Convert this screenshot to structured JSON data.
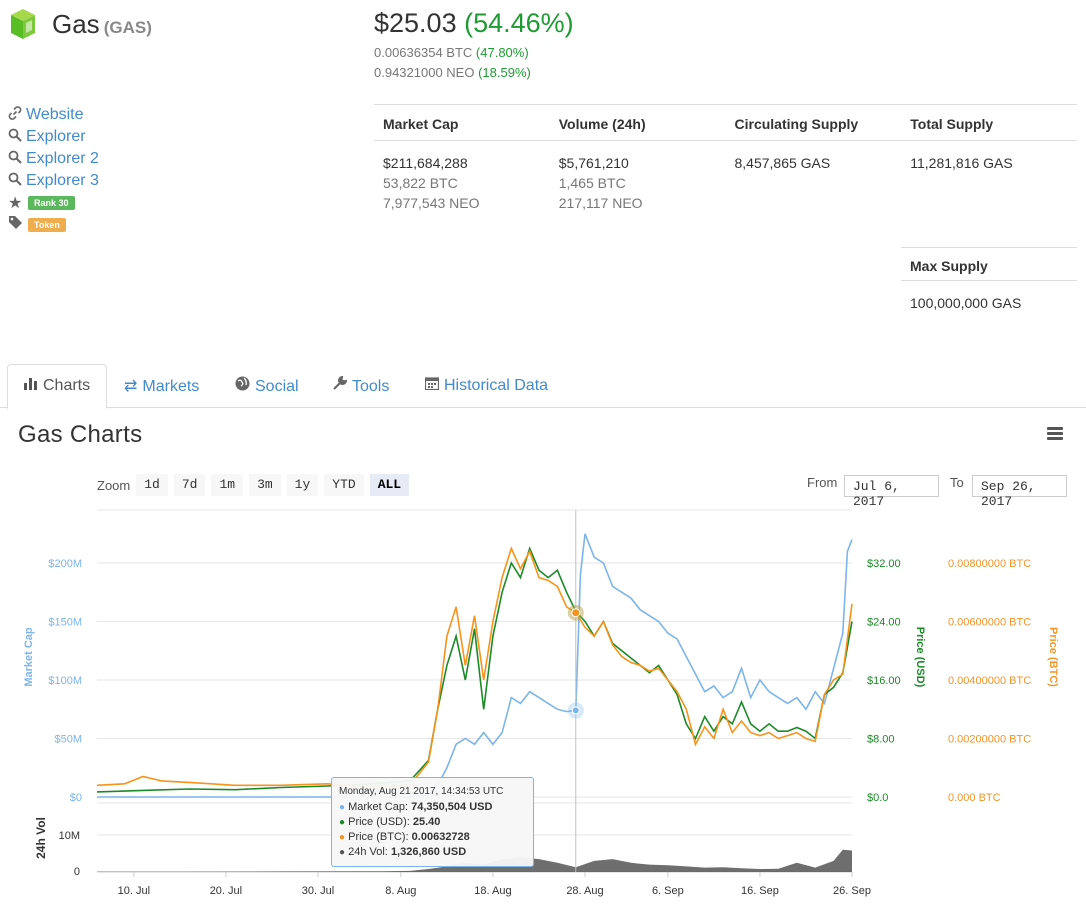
{
  "coin": {
    "name": "Gas",
    "symbol": "(GAS)",
    "price_usd": "$25.03",
    "change_usd": "(54.46%)",
    "price_btc": "0.00636354 BTC",
    "change_btc": "(47.80%)",
    "price_neo": "0.94321000 NEO",
    "change_neo": "(18.59%)"
  },
  "links": {
    "website": "Website",
    "explorer": "Explorer",
    "explorer2": "Explorer 2",
    "explorer3": "Explorer 3",
    "rank": "Rank 30",
    "token": "Token"
  },
  "stats": {
    "headers": [
      "Market Cap",
      "Volume (24h)",
      "Circulating Supply",
      "Total Supply"
    ],
    "market_cap": [
      "$211,684,288",
      "53,822 BTC",
      "7,977,543 NEO"
    ],
    "volume": [
      "$5,761,210",
      "1,465 BTC",
      "217,117 NEO"
    ],
    "circulating": "8,457,865 GAS",
    "total": "11,281,816 GAS",
    "max_label": "Max Supply",
    "max_value": "100,000,000 GAS"
  },
  "tabs": [
    "Charts",
    "Markets",
    "Social",
    "Tools",
    "Historical Data"
  ],
  "charts": {
    "title": "Gas Charts",
    "zoom_label": "Zoom",
    "zoom_buttons": [
      "1d",
      "7d",
      "1m",
      "3m",
      "1y",
      "YTD",
      "ALL"
    ],
    "zoom_selected": "ALL",
    "from_label": "From",
    "from_value": "Jul 6, 2017",
    "to_label": "To",
    "to_value": "Sep 26, 2017"
  },
  "tooltip": {
    "date": "Monday, Aug 21 2017, 14:34:53 UTC",
    "market_cap_label": "Market Cap: ",
    "market_cap": "74,350,504 USD",
    "price_usd_label": "Price (USD): ",
    "price_usd": "25.40",
    "price_btc_label": "Price (BTC): ",
    "price_btc": "0.00632728",
    "vol_label": "24h Vol: ",
    "vol": "1,326,860 USD"
  },
  "colors": {
    "market_cap": "#7cb5ec",
    "price_usd": "#1c8a28",
    "price_btc": "#f7931a",
    "volume": "#555555",
    "link": "#428bca",
    "positive": "#1e9b34"
  },
  "chart_data": {
    "type": "line",
    "x_ticks": [
      "10. Jul",
      "20. Jul",
      "30. Jul",
      "8. Aug",
      "18. Aug",
      "28. Aug",
      "6. Sep",
      "16. Sep",
      "26. Sep"
    ],
    "axes": {
      "market_cap": {
        "label": "Market Cap",
        "ticks": [
          "$0",
          "$50M",
          "$100M",
          "$150M",
          "$200M"
        ],
        "range": [
          0,
          230000000
        ]
      },
      "price_usd": {
        "label": "Price (USD)",
        "ticks": [
          "$0.0",
          "$8.00",
          "$16.00",
          "$24.00",
          "$32.00"
        ],
        "range": [
          0,
          36
        ]
      },
      "price_btc": {
        "label": "Price (BTC)",
        "ticks": [
          "0.000 BTC",
          "0.00200000 BTC",
          "0.00400000 BTC",
          "0.00600000 BTC",
          "0.00800000 BTC"
        ],
        "range": [
          0,
          0.009
        ]
      },
      "volume": {
        "label": "24h Vol",
        "ticks": [
          "0",
          "10M"
        ],
        "range": [
          0,
          12000000
        ]
      }
    },
    "x_range_days": [
      0,
      82
    ],
    "series": [
      {
        "name": "Market Cap",
        "points": [
          [
            0,
            0
          ],
          [
            10,
            0
          ],
          [
            20,
            0
          ],
          [
            30,
            0
          ],
          [
            34,
            0
          ],
          [
            36,
            2000000
          ],
          [
            37,
            10000000
          ],
          [
            38,
            25000000
          ],
          [
            39,
            45000000
          ],
          [
            40,
            50000000
          ],
          [
            41,
            45000000
          ],
          [
            42,
            55000000
          ],
          [
            43,
            45000000
          ],
          [
            44,
            55000000
          ],
          [
            45,
            85000000
          ],
          [
            46,
            80000000
          ],
          [
            47,
            90000000
          ],
          [
            48,
            85000000
          ],
          [
            49,
            80000000
          ],
          [
            50,
            75000000
          ],
          [
            51,
            73000000
          ],
          [
            52,
            74000000
          ],
          [
            52.5,
            190000000
          ],
          [
            53,
            225000000
          ],
          [
            54,
            205000000
          ],
          [
            55,
            200000000
          ],
          [
            56,
            180000000
          ],
          [
            57,
            175000000
          ],
          [
            58,
            170000000
          ],
          [
            59,
            160000000
          ],
          [
            60,
            155000000
          ],
          [
            61,
            150000000
          ],
          [
            62,
            140000000
          ],
          [
            63,
            135000000
          ],
          [
            64,
            120000000
          ],
          [
            65,
            105000000
          ],
          [
            66,
            90000000
          ],
          [
            67,
            95000000
          ],
          [
            68,
            85000000
          ],
          [
            69,
            90000000
          ],
          [
            70,
            110000000
          ],
          [
            71,
            85000000
          ],
          [
            72,
            100000000
          ],
          [
            73,
            90000000
          ],
          [
            74,
            85000000
          ],
          [
            75,
            80000000
          ],
          [
            76,
            85000000
          ],
          [
            77,
            75000000
          ],
          [
            78,
            90000000
          ],
          [
            79,
            80000000
          ],
          [
            80,
            110000000
          ],
          [
            81,
            140000000
          ],
          [
            81.5,
            210000000
          ],
          [
            82,
            220000000
          ]
        ]
      },
      {
        "name": "Price (USD)",
        "points": [
          [
            0,
            0.7
          ],
          [
            5,
            0.9
          ],
          [
            10,
            1.1
          ],
          [
            15,
            1.0
          ],
          [
            20,
            1.3
          ],
          [
            25,
            1.5
          ],
          [
            30,
            1.8
          ],
          [
            34,
            2.2
          ],
          [
            36,
            5
          ],
          [
            37,
            12
          ],
          [
            38,
            18
          ],
          [
            39,
            22
          ],
          [
            40,
            16
          ],
          [
            41,
            23
          ],
          [
            42,
            12
          ],
          [
            43,
            22
          ],
          [
            44,
            28
          ],
          [
            45,
            32
          ],
          [
            46,
            30
          ],
          [
            47,
            34
          ],
          [
            48,
            31
          ],
          [
            49,
            30
          ],
          [
            50,
            31
          ],
          [
            51,
            28
          ],
          [
            52,
            25.4
          ],
          [
            53,
            24
          ],
          [
            54,
            22
          ],
          [
            55,
            24
          ],
          [
            56,
            21
          ],
          [
            57,
            20
          ],
          [
            58,
            19
          ],
          [
            59,
            18
          ],
          [
            60,
            17
          ],
          [
            61,
            18
          ],
          [
            62,
            16
          ],
          [
            63,
            14
          ],
          [
            64,
            10
          ],
          [
            65,
            8
          ],
          [
            66,
            11
          ],
          [
            67,
            9
          ],
          [
            68,
            11
          ],
          [
            69,
            10
          ],
          [
            70,
            13
          ],
          [
            71,
            10
          ],
          [
            72,
            9
          ],
          [
            73,
            10
          ],
          [
            74,
            9
          ],
          [
            75,
            9
          ],
          [
            76,
            9.5
          ],
          [
            77,
            9
          ],
          [
            78,
            8
          ],
          [
            79,
            14
          ],
          [
            80,
            15
          ],
          [
            81,
            17
          ],
          [
            82,
            24
          ]
        ]
      },
      {
        "name": "Price (BTC)",
        "points": [
          [
            0,
            0.0004
          ],
          [
            3,
            0.00045
          ],
          [
            5,
            0.0007
          ],
          [
            7,
            0.00055
          ],
          [
            10,
            0.0005
          ],
          [
            15,
            0.0004
          ],
          [
            20,
            0.0004
          ],
          [
            25,
            0.00045
          ],
          [
            30,
            0.00035
          ],
          [
            34,
            0.0004
          ],
          [
            36,
            0.0012
          ],
          [
            37,
            0.003
          ],
          [
            38,
            0.0055
          ],
          [
            39,
            0.0065
          ],
          [
            40,
            0.0045
          ],
          [
            41,
            0.0062
          ],
          [
            42,
            0.004
          ],
          [
            43,
            0.006
          ],
          [
            44,
            0.0075
          ],
          [
            45,
            0.0085
          ],
          [
            46,
            0.0078
          ],
          [
            47,
            0.0084
          ],
          [
            48,
            0.0075
          ],
          [
            49,
            0.0074
          ],
          [
            50,
            0.0072
          ],
          [
            51,
            0.0065
          ],
          [
            52,
            0.0063
          ],
          [
            53,
            0.0058
          ],
          [
            54,
            0.0055
          ],
          [
            55,
            0.006
          ],
          [
            56,
            0.0052
          ],
          [
            57,
            0.0048
          ],
          [
            58,
            0.0046
          ],
          [
            59,
            0.0045
          ],
          [
            60,
            0.0043
          ],
          [
            61,
            0.0044
          ],
          [
            62,
            0.004
          ],
          [
            63,
            0.0036
          ],
          [
            64,
            0.003
          ],
          [
            65,
            0.0018
          ],
          [
            66,
            0.0024
          ],
          [
            67,
            0.002
          ],
          [
            68,
            0.003
          ],
          [
            69,
            0.0022
          ],
          [
            70,
            0.0026
          ],
          [
            71,
            0.0022
          ],
          [
            72,
            0.0021
          ],
          [
            73,
            0.0022
          ],
          [
            74,
            0.002
          ],
          [
            75,
            0.0021
          ],
          [
            76,
            0.0022
          ],
          [
            77,
            0.002
          ],
          [
            78,
            0.0019
          ],
          [
            79,
            0.0035
          ],
          [
            80,
            0.004
          ],
          [
            81,
            0.0042
          ],
          [
            82,
            0.0066
          ]
        ]
      },
      {
        "name": "24h Vol",
        "points": [
          [
            0,
            100000
          ],
          [
            10,
            100000
          ],
          [
            20,
            150000
          ],
          [
            30,
            200000
          ],
          [
            34,
            300000
          ],
          [
            36,
            800000
          ],
          [
            38,
            1500000
          ],
          [
            40,
            2500000
          ],
          [
            42,
            2000000
          ],
          [
            44,
            3500000
          ],
          [
            46,
            4000000
          ],
          [
            48,
            3500000
          ],
          [
            50,
            2500000
          ],
          [
            52,
            1300000
          ],
          [
            54,
            3000000
          ],
          [
            56,
            3500000
          ],
          [
            58,
            2500000
          ],
          [
            60,
            2000000
          ],
          [
            62,
            1800000
          ],
          [
            64,
            1500000
          ],
          [
            66,
            1200000
          ],
          [
            68,
            1300000
          ],
          [
            70,
            1000000
          ],
          [
            72,
            800000
          ],
          [
            74,
            900000
          ],
          [
            76,
            2500000
          ],
          [
            78,
            1200000
          ],
          [
            80,
            3000000
          ],
          [
            81,
            6000000
          ],
          [
            82,
            5800000
          ]
        ]
      }
    ],
    "highlight_day": 52
  }
}
